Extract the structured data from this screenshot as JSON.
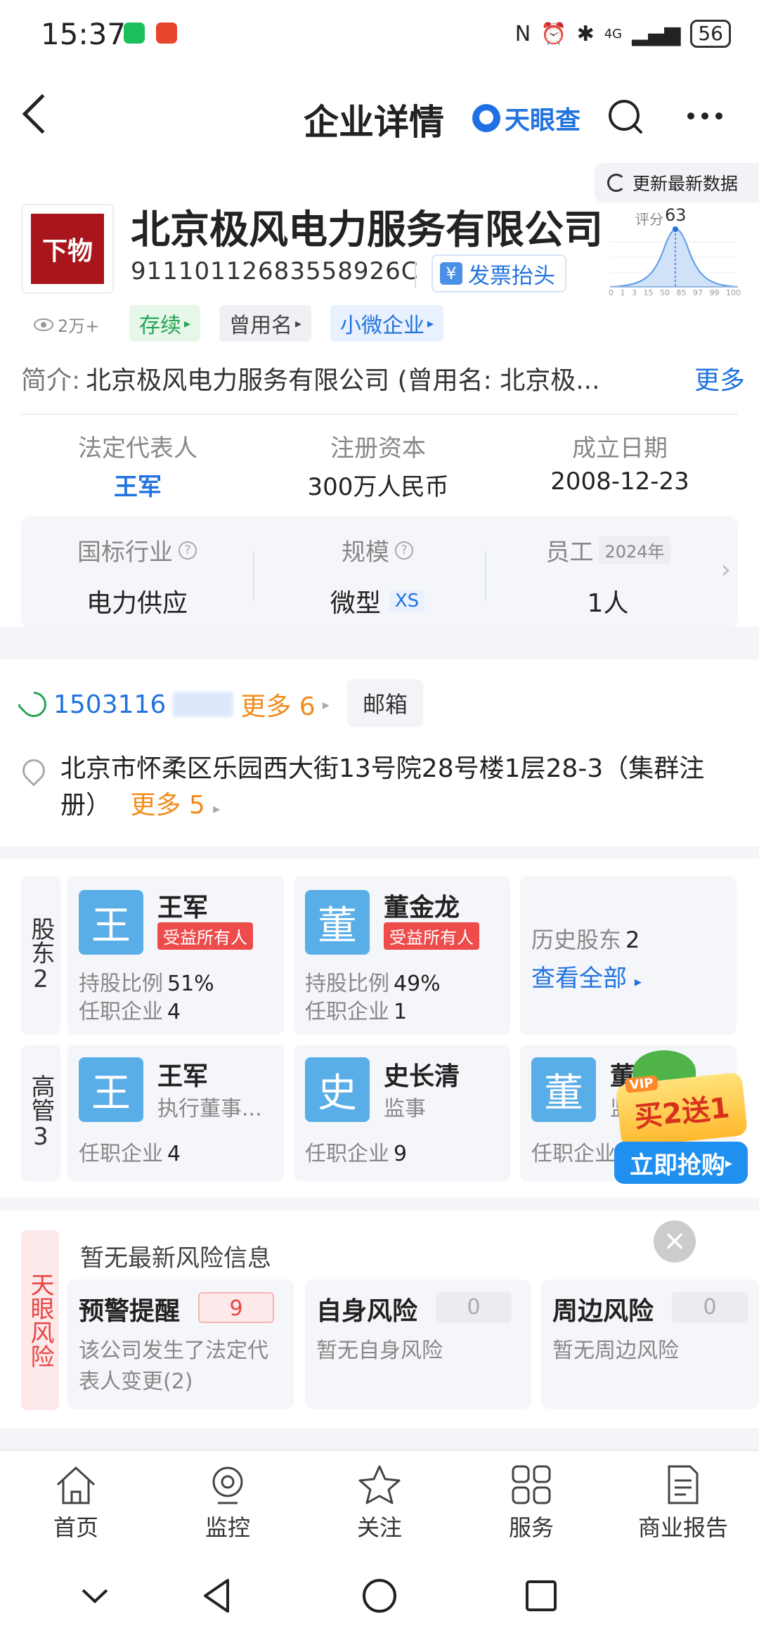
{
  "status_bar": {
    "time": "15:37",
    "network": "4G",
    "battery": "56"
  },
  "header": {
    "title": "企业详情",
    "brand": "天眼查"
  },
  "refresh_label": "更新最新数据",
  "company": {
    "logo_text": "下物",
    "name": "北京极风电力服务有限公司",
    "credit_code": "91110112683558926C",
    "invoice_label": "发票抬头",
    "score_label": "评分",
    "score_value": "63",
    "score_axis": [
      "0",
      "1",
      "3",
      "15",
      "50",
      "85",
      "97",
      "99",
      "100"
    ],
    "views": "2万+",
    "tags": [
      "存续",
      "曾用名",
      "小微企业"
    ],
    "intro_label": "简介:",
    "intro_text": "北京极风电力服务有限公司 (曾用名: 北京极...",
    "intro_more": "更多"
  },
  "key_info": [
    {
      "label": "法定代表人",
      "value": "王军"
    },
    {
      "label": "注册资本",
      "value": "300万人民币"
    },
    {
      "label": "成立日期",
      "value": "2008-12-23"
    }
  ],
  "industry": [
    {
      "label": "国标行业",
      "value": "电力供应"
    },
    {
      "label": "规模",
      "value": "微型",
      "badge": "XS"
    },
    {
      "label": "员工",
      "year": "2024年",
      "value": "1人"
    }
  ],
  "contact": {
    "phone": "1503116",
    "phone_more": "更多 6",
    "email": "邮箱",
    "address": "北京市怀柔区乐园西大街13号院28号楼1层28-3（集群注册）",
    "address_more": "更多 5"
  },
  "shareholders": {
    "label": "股东",
    "count": "2",
    "items": [
      {
        "avatar": "王",
        "name": "王军",
        "badge": "受益所有人",
        "ratio_label": "持股比例",
        "ratio": "51%",
        "jobs_label": "任职企业",
        "jobs": "4"
      },
      {
        "avatar": "董",
        "name": "董金龙",
        "badge": "受益所有人",
        "ratio_label": "持股比例",
        "ratio": "49%",
        "jobs_label": "任职企业",
        "jobs": "1"
      }
    ],
    "history_label": "历史股东",
    "history_count": "2",
    "view_all": "查看全部"
  },
  "executives": {
    "label": "高管",
    "count": "3",
    "items": [
      {
        "avatar": "王",
        "name": "王军",
        "role": "执行董事...",
        "jobs_label": "任职企业",
        "jobs": "4"
      },
      {
        "avatar": "史",
        "name": "史长清",
        "role": "监事",
        "jobs_label": "任职企业",
        "jobs": "9"
      },
      {
        "avatar": "董",
        "name": "董",
        "role": "监",
        "jobs_label": "任职企业",
        "jobs": ""
      }
    ]
  },
  "promo": {
    "vip": "VIP",
    "line1": "买2送1",
    "line2": "立即抢购"
  },
  "risk": {
    "side_label": "天眼风险",
    "title": "暂无最新风险信息",
    "cards": [
      {
        "title": "预警提醒",
        "count": "9",
        "desc": "该公司发生了法定代表人变更(2)"
      },
      {
        "title": "自身风险",
        "count": "0",
        "desc": "暂无自身风险"
      },
      {
        "title": "周边风险",
        "count": "0",
        "desc": "暂无周边风险"
      }
    ]
  },
  "bottom_nav": [
    "首页",
    "监控",
    "关注",
    "服务",
    "商业报告"
  ],
  "colors": {
    "brand_blue": "#2273e0",
    "risk_red": "#e94545",
    "orange": "#f08c1b",
    "green": "#23a552"
  }
}
